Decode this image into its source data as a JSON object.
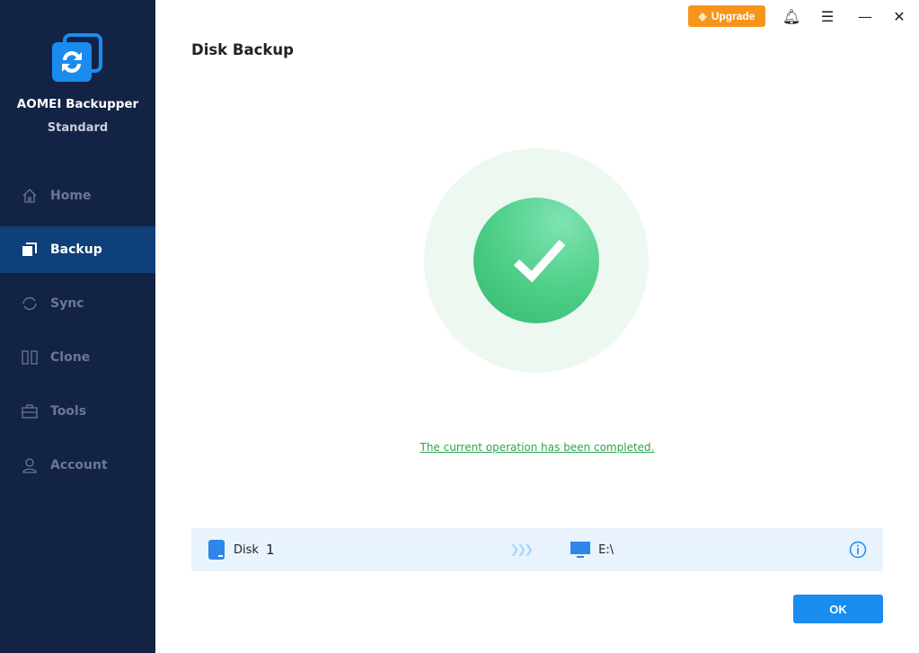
{
  "app": {
    "name": "AOMEI Backupper",
    "edition": "Standard"
  },
  "nav": [
    {
      "label": "Home"
    },
    {
      "label": "Backup"
    },
    {
      "label": "Sync"
    },
    {
      "label": "Clone"
    },
    {
      "label": "Tools"
    },
    {
      "label": "Account"
    }
  ],
  "titlebar": {
    "upgrade_label": "Upgrade"
  },
  "page": {
    "title": "Disk Backup",
    "status_message": "The current operation has been completed."
  },
  "operation": {
    "source": "Disk",
    "source_number": "1",
    "destination": "E:\\"
  },
  "actions": {
    "ok_label": "OK"
  },
  "colors": {
    "sidebar": "#132346",
    "active": "#0e4079",
    "accent": "#1a8cf0",
    "success": "#4fcf88",
    "upgrade": "#f7941d"
  }
}
